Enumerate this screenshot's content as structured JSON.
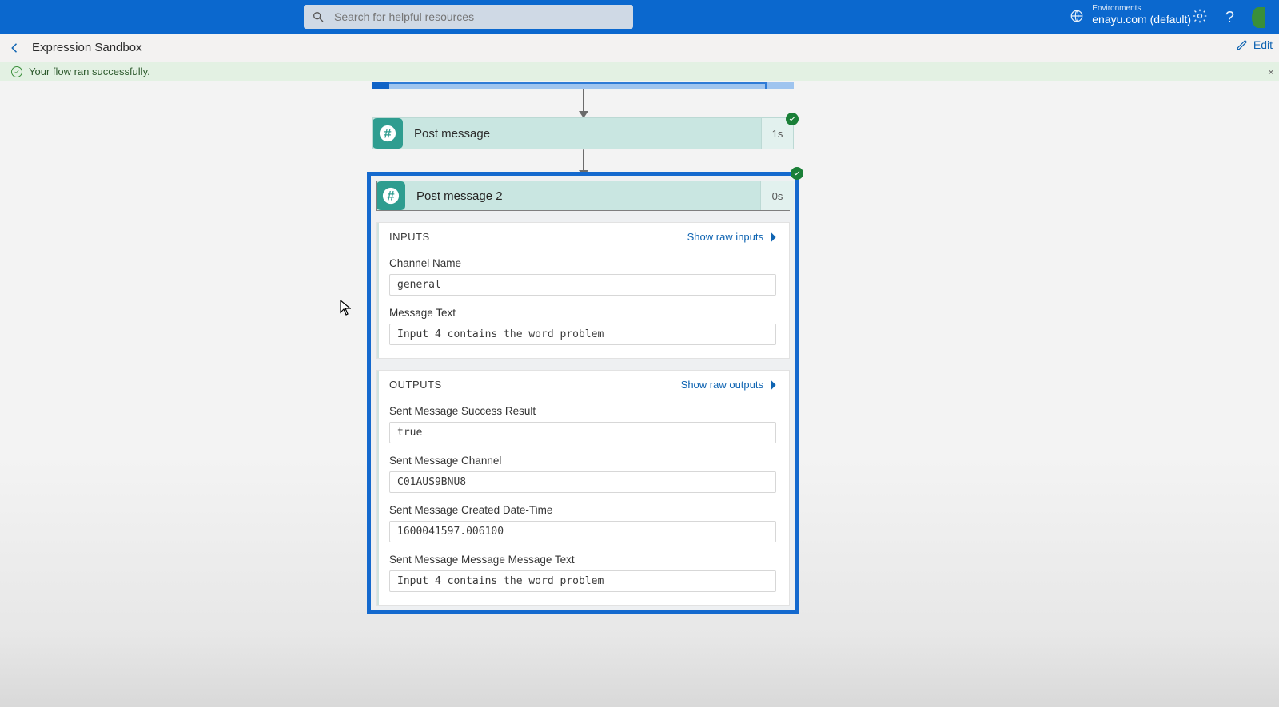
{
  "header": {
    "search_placeholder": "Search for helpful resources",
    "env_label": "Environments",
    "env_name": "enayu.com (default)"
  },
  "breadcrumb": {
    "title": "Expression Sandbox",
    "edit_label": "Edit"
  },
  "banner": {
    "message": "Your flow ran successfully."
  },
  "flow": {
    "step1": {
      "label": "Post message",
      "duration": "1s"
    },
    "step2": {
      "label": "Post message 2",
      "duration": "0s"
    }
  },
  "panels": {
    "inputs": {
      "title": "INPUTS",
      "link": "Show raw inputs",
      "fields": {
        "channel_name": {
          "label": "Channel Name",
          "value": "general"
        },
        "message_text": {
          "label": "Message Text",
          "value": "Input 4 contains the word problem"
        }
      }
    },
    "outputs": {
      "title": "OUTPUTS",
      "link": "Show raw outputs",
      "fields": {
        "success": {
          "label": "Sent Message Success Result",
          "value": "true"
        },
        "channel": {
          "label": "Sent Message Channel",
          "value": "C01AUS9BNU8"
        },
        "created": {
          "label": "Sent Message Created Date-Time",
          "value": "1600041597.006100"
        },
        "text": {
          "label": "Sent Message Message Message Text",
          "value": "Input 4 contains the word problem"
        }
      }
    }
  }
}
